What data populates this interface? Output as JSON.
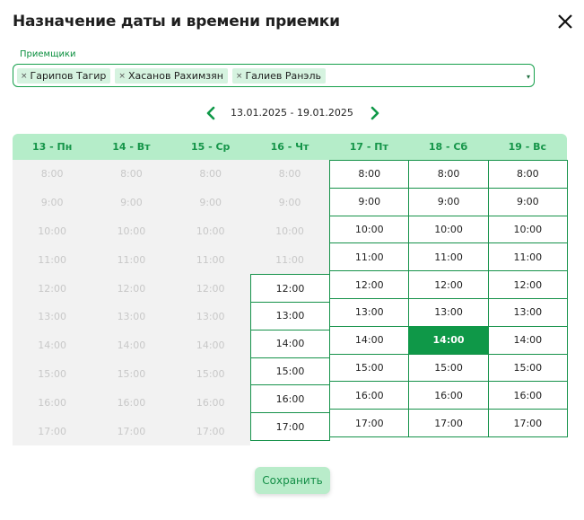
{
  "dialog": {
    "title": "Назначение даты и времени приемки",
    "close_icon": "close-icon"
  },
  "receivers": {
    "label": "Приемщики",
    "selected": [
      "Гарипов Тагир",
      "Хасанов Рахимзян",
      "Галиев Ранэль"
    ],
    "chip_remove_glyph": "×",
    "dropdown_glyph": "▾"
  },
  "week_nav": {
    "range": "13.01.2025 - 19.01.2025",
    "prev_icon": "chevron-left-icon",
    "next_icon": "chevron-right-icon"
  },
  "schedule": {
    "days": [
      {
        "label": "13 - Пн",
        "first_available": null
      },
      {
        "label": "14 - Вт",
        "first_available": null
      },
      {
        "label": "15 - Ср",
        "first_available": null
      },
      {
        "label": "16 - Чт",
        "first_available": "12:00"
      },
      {
        "label": "17 - Пт",
        "first_available": "8:00"
      },
      {
        "label": "18 - Сб",
        "first_available": "8:00"
      },
      {
        "label": "19 - Вс",
        "first_available": "8:00"
      }
    ],
    "times": [
      "8:00",
      "9:00",
      "10:00",
      "11:00",
      "12:00",
      "13:00",
      "14:00",
      "15:00",
      "16:00",
      "17:00"
    ],
    "selected": {
      "day": "18 - Сб",
      "time": "14:00"
    }
  },
  "actions": {
    "save_label": "Сохранить"
  },
  "colors": {
    "accent": "#0f9848",
    "header_bg": "#b5edc9",
    "disabled_bg": "#f2f2f2"
  }
}
